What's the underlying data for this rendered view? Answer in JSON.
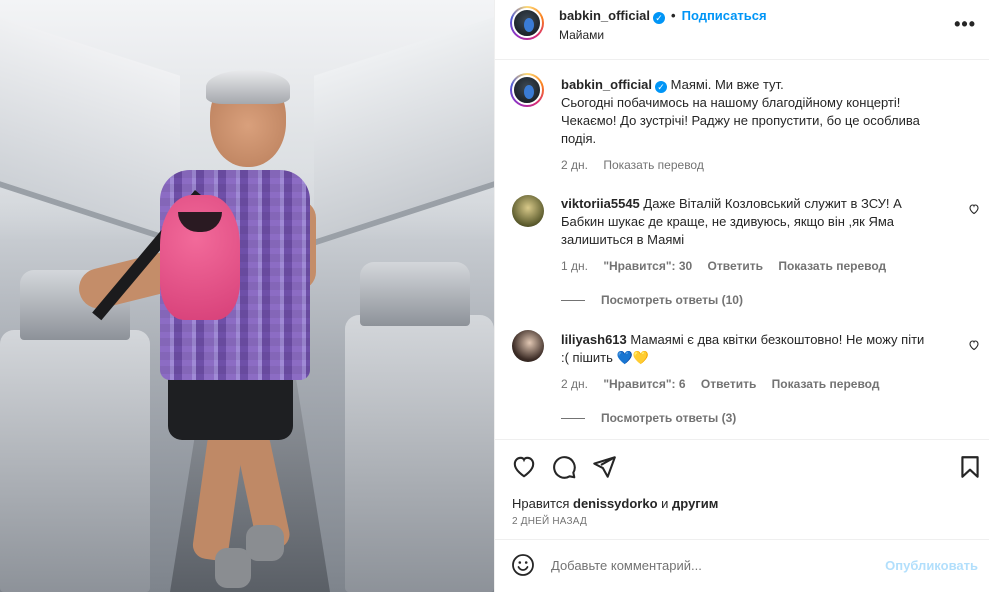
{
  "post": {
    "username": "babkin_official",
    "verified_mark": "✓",
    "dot": "•",
    "follow_label": "Подписаться",
    "location": "Майами",
    "more_icon": "•••"
  },
  "caption": {
    "username": "babkin_official",
    "text_line1": "Маямі. Ми вже тут.",
    "text_line2": "Сьогодні побачимось на нашому благодійному концерті!",
    "text_line3": "Чекаємо! До зустрічі! Раджу не пропустити, бо це особлива",
    "text_line4": "подія.",
    "time": "2 дн.",
    "translate": "Показать перевод"
  },
  "comments": [
    {
      "username": "viktoriia5545",
      "text_line1": "Даже Віталій Козловський служит в ЗСУ! А",
      "text_line2": "Бабкин шукає де краще, не здивуюсь, якщо він ,як Яма",
      "text_line3": "залишиться в Маямі",
      "time": "1 дн.",
      "likes": "\"Нравится\": 30",
      "reply": "Ответить",
      "translate": "Показать перевод",
      "view_replies": "Посмотреть ответы (10)"
    },
    {
      "username": "liliyash613",
      "text_line1": "Мамаямі є два квітки безкоштовно! Не можу піти",
      "text_line2": ":( пішить 💙💛",
      "time": "2 дн.",
      "likes": "\"Нравится\": 6",
      "reply": "Ответить",
      "translate": "Показать перевод",
      "view_replies": "Посмотреть ответы (3)"
    }
  ],
  "actions": {
    "likes_prefix": "Нравится",
    "likes_user": "denissydorko",
    "likes_and": "и",
    "likes_others": "другим",
    "date": "2 ДНЕЙ НАЗАД"
  },
  "add_comment": {
    "placeholder": "Добавьте комментарий...",
    "post_label": "Опубликовать"
  },
  "colors": {
    "accent": "#0095f6",
    "text": "#262626",
    "secondary": "#737373",
    "post_disabled": "#b2dffc"
  }
}
